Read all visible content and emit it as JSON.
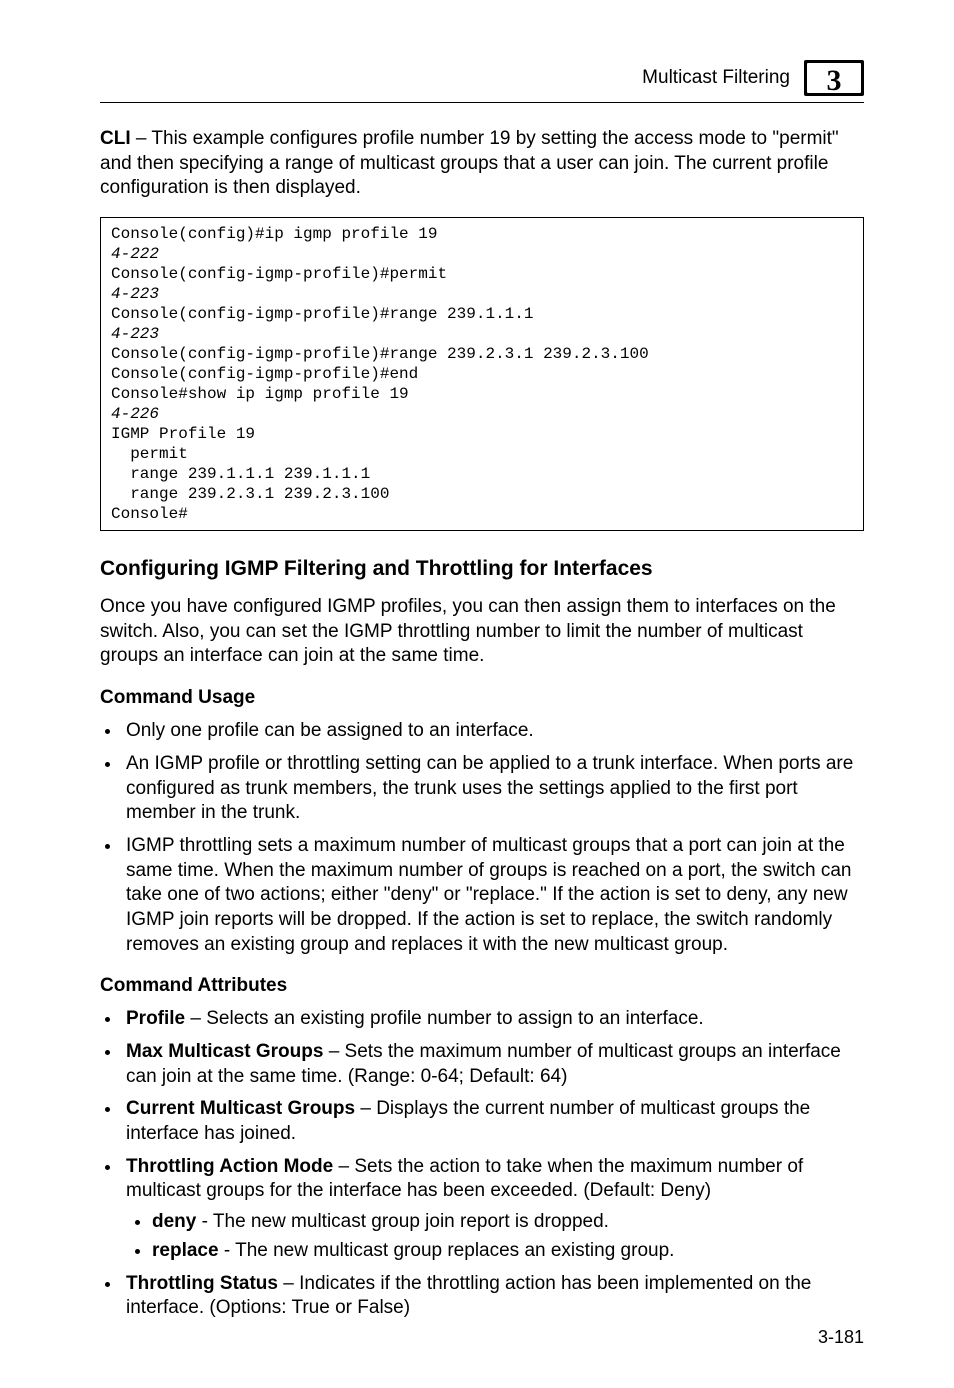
{
  "header": {
    "title": "Multicast Filtering",
    "chapter_num": "3"
  },
  "intro": {
    "lead_bold": "CLI",
    "lead_rest": " – This example configures profile number 19 by setting the access mode to \"permit\" and then specifying a range of multicast groups that a user can join. The current profile configuration is then displayed."
  },
  "code": {
    "l1": "Console(config)#ip igmp profile 19",
    "r1": "4-222",
    "l2": "Console(config-igmp-profile)#permit",
    "r2": "4-223",
    "l3": "Console(config-igmp-profile)#range 239.1.1.1",
    "r3": "4-223",
    "l4": "Console(config-igmp-profile)#range 239.2.3.1 239.2.3.100",
    "l5": "Console(config-igmp-profile)#end",
    "l6": "Console#show ip igmp profile 19",
    "r4": "4-226",
    "l7": "IGMP Profile 19",
    "l8": "  permit",
    "l9": "  range 239.1.1.1 239.1.1.1",
    "l10": "  range 239.2.3.1 239.2.3.100",
    "l11": "Console#"
  },
  "section": {
    "heading": "Configuring IGMP Filtering and Throttling for Interfaces",
    "para": "Once you have configured IGMP profiles, you can then assign them to interfaces on the switch. Also, you can set the IGMP throttling number to limit the number of multicast groups an interface can join at the same time."
  },
  "usage": {
    "heading": "Command Usage",
    "b1": "Only one profile can be assigned to an interface.",
    "b2": "An IGMP profile or throttling setting can be applied to a trunk interface. When ports are configured as trunk members, the trunk uses the settings applied to the first port member in the trunk.",
    "b3": "IGMP throttling sets a maximum number of multicast groups that a port can join at the same time. When the maximum number of groups is reached on a port, the switch can take one of two actions; either \"deny\" or \"replace.\" If the action is set to deny, any new IGMP join reports will be dropped. If the action is set to replace, the switch randomly removes an existing group and replaces it with the new multicast group."
  },
  "attrs": {
    "heading": "Command Attributes",
    "i1_b": "Profile",
    "i1_r": " – Selects an existing profile number to assign to an interface.",
    "i2_b": "Max Multicast Groups",
    "i2_r": " – Sets the maximum number of multicast groups an interface can join at the same time. (Range: 0-64; Default: 64)",
    "i3_b": "Current Multicast Groups",
    "i3_r": " – Displays the current number of multicast groups the interface has joined.",
    "i4_b": "Throttling Action Mode",
    "i4_r": " – Sets the action to take when the maximum number of multicast groups for the interface has been exceeded. (Default: Deny)",
    "i4s1_b": "deny",
    "i4s1_r": " - The new multicast group join report is dropped.",
    "i4s2_b": "replace",
    "i4s2_r": " - The new multicast group replaces an existing group.",
    "i5_b": "Throttling Status",
    "i5_r": " – Indicates if the throttling action has been implemented on the interface. (Options: True or False)"
  },
  "footer": {
    "page": "3-181"
  }
}
